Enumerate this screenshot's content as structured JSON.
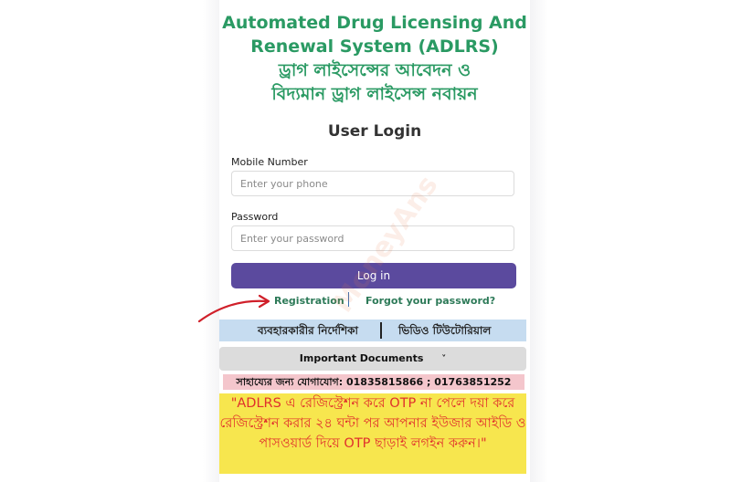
{
  "title": {
    "line1": "Automated Drug Licensing And",
    "line2": "Renewal System (ADLRS)",
    "line3": "ড্রাগ লাইসেন্সের আবেদন ও",
    "line4": "বিদ্যমান ড্রাগ লাইসেন্স নবায়ন"
  },
  "login": {
    "heading": "User Login",
    "mobile_label": "Mobile Number",
    "mobile_placeholder": "Enter your phone",
    "password_label": "Password",
    "password_placeholder": "Enter your password",
    "button_label": "Log in"
  },
  "links": {
    "registration": "Registration",
    "forgot": "Forgot your password?"
  },
  "guide_bar": {
    "user_guide": "ব্যবহারকারীর নির্দেশিকা",
    "video_tutorial": "ভিডিও টিউটোরিয়াল"
  },
  "documents": {
    "label": "Important Documents",
    "chevron": "˅"
  },
  "help": {
    "contact": "সাহায্যের জন্য যোগাযোগ: 01835815866 ; 01763851252"
  },
  "notice": {
    "text": "\"ADLRS এ রেজিস্ট্রেশন করে OTP না পেলে দয়া করে রেজিস্ট্রেশন করার ২৪ ঘন্টা পর আপনার ইউজার আইডি ও পাসওয়ার্ড দিয়ে OTP ছাড়াই লগইন করুন।\""
  },
  "watermark": "MoneyAns",
  "colors": {
    "title_green": "#2a9a63",
    "button_purple": "#5b4a9e",
    "link_green": "#2d7a58",
    "guide_blue": "#c6dcf0",
    "help_pink": "#f4c6cc",
    "notice_yellow": "#f7e64e",
    "notice_red": "#e0302c",
    "arrow_red": "#d0202a"
  }
}
